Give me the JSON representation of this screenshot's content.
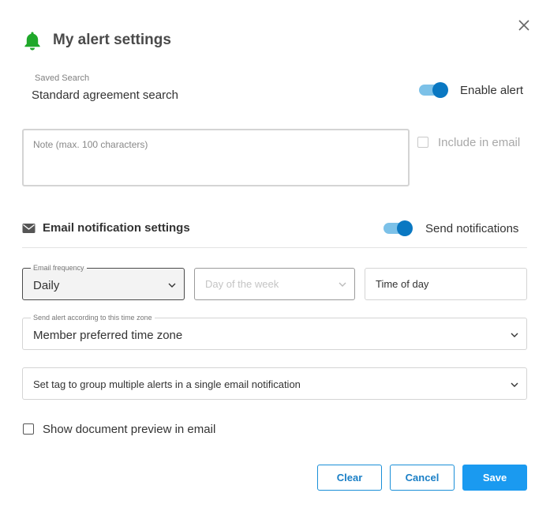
{
  "dialog": {
    "title": "My alert settings",
    "close_icon": "close-icon"
  },
  "saved_search": {
    "label": "Saved Search",
    "value": "Standard agreement search"
  },
  "enable_alert": {
    "label": "Enable alert",
    "on": true
  },
  "note": {
    "placeholder": "Note (max. 100 characters)",
    "value": ""
  },
  "include_in_email": {
    "label": "Include in email",
    "checked": false,
    "disabled": true
  },
  "email_section": {
    "title": "Email notification settings",
    "icon": "envelope-icon"
  },
  "send_notifications": {
    "label": "Send notifications",
    "on": true
  },
  "frequency": {
    "legend": "Email frequency",
    "value": "Daily"
  },
  "day_of_week": {
    "placeholder": "Day of the week"
  },
  "time_of_day": {
    "placeholder": "Time of day"
  },
  "time_zone": {
    "legend": "Send alert according to this time zone",
    "value": "Member preferred time zone"
  },
  "tag": {
    "placeholder": "Set tag to group multiple alerts in a single email notification"
  },
  "preview": {
    "label": "Show document preview in email",
    "checked": false
  },
  "buttons": {
    "clear": "Clear",
    "cancel": "Cancel",
    "save": "Save"
  },
  "colors": {
    "accent": "#1a9af0",
    "toggle_knob": "#0a78c2",
    "toggle_track": "#7cc1e8",
    "bell": "#1fa82a"
  }
}
